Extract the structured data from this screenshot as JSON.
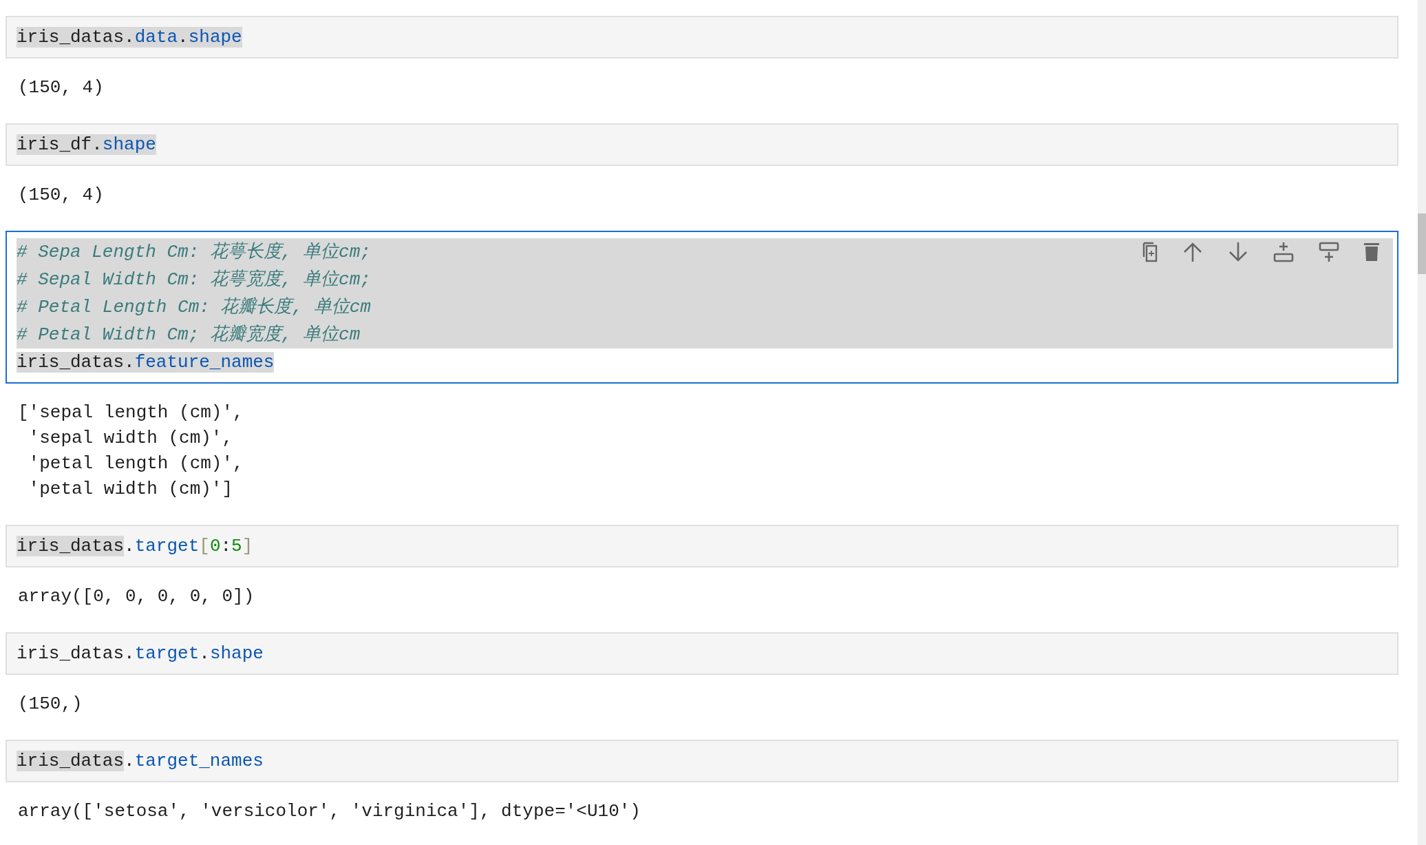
{
  "cells": [
    {
      "kind": "code",
      "selected": false,
      "lines": [
        {
          "selected": false,
          "tokens": [
            {
              "text": "iris_datas",
              "kind": "name",
              "highlighted": true
            },
            {
              "text": ".",
              "kind": "punct",
              "highlighted": true
            },
            {
              "text": "data",
              "kind": "attr",
              "highlighted": true
            },
            {
              "text": ".",
              "kind": "punct",
              "highlighted": true
            },
            {
              "text": "shape",
              "kind": "attr",
              "highlighted": true
            }
          ]
        }
      ],
      "output": [
        "(150, 4)"
      ]
    },
    {
      "kind": "code",
      "selected": false,
      "lines": [
        {
          "selected": false,
          "tokens": [
            {
              "text": "iris_df",
              "kind": "name",
              "highlighted": true
            },
            {
              "text": ".",
              "kind": "punct",
              "highlighted": true
            },
            {
              "text": "shape",
              "kind": "attr",
              "highlighted": true
            }
          ]
        }
      ],
      "output": [
        "(150, 4)"
      ]
    },
    {
      "kind": "code",
      "selected": true,
      "lines": [
        {
          "selected": true,
          "tokens": [
            {
              "text": "# Sepa Length Cm: 花萼长度, 单位cm;",
              "kind": "comment"
            }
          ]
        },
        {
          "selected": true,
          "tokens": [
            {
              "text": "# Sepal Width Cm: 花萼宽度, 单位cm;",
              "kind": "comment"
            }
          ]
        },
        {
          "selected": true,
          "tokens": [
            {
              "text": "# Petal Length Cm: 花瓣长度, 单位cm",
              "kind": "comment"
            }
          ]
        },
        {
          "selected": true,
          "tokens": [
            {
              "text": "# Petal Width Cm; 花瓣宽度, 单位cm",
              "kind": "comment"
            }
          ]
        },
        {
          "selected": false,
          "tokens": [
            {
              "text": "iris_datas",
              "kind": "name",
              "highlighted": true
            },
            {
              "text": ".",
              "kind": "punct",
              "highlighted": true
            },
            {
              "text": "feature_names",
              "kind": "attr",
              "highlighted": true
            }
          ]
        }
      ],
      "output": [
        "['sepal length (cm)',",
        " 'sepal width (cm)',",
        " 'petal length (cm)',",
        " 'petal width (cm)']"
      ]
    },
    {
      "kind": "code",
      "selected": false,
      "lines": [
        {
          "selected": false,
          "tokens": [
            {
              "text": "iris_datas",
              "kind": "name",
              "highlighted": true
            },
            {
              "text": ".",
              "kind": "punct",
              "highlighted": false
            },
            {
              "text": "target",
              "kind": "attr",
              "highlighted": false
            },
            {
              "text": "[",
              "kind": "bracket",
              "highlighted": false
            },
            {
              "text": "0",
              "kind": "number",
              "highlighted": false
            },
            {
              "text": ":",
              "kind": "punct",
              "highlighted": false
            },
            {
              "text": "5",
              "kind": "number",
              "highlighted": false
            },
            {
              "text": "]",
              "kind": "bracket",
              "highlighted": false
            }
          ]
        }
      ],
      "output": [
        "array([0, 0, 0, 0, 0])"
      ]
    },
    {
      "kind": "code",
      "selected": false,
      "lines": [
        {
          "selected": false,
          "tokens": [
            {
              "text": "iris_datas",
              "kind": "name",
              "highlighted": false
            },
            {
              "text": ".",
              "kind": "punct",
              "highlighted": false
            },
            {
              "text": "target",
              "kind": "attr",
              "highlighted": false
            },
            {
              "text": ".",
              "kind": "punct",
              "highlighted": false
            },
            {
              "text": "shape",
              "kind": "attr",
              "highlighted": false
            }
          ]
        }
      ],
      "output": [
        "(150,)"
      ]
    },
    {
      "kind": "code",
      "selected": false,
      "lines": [
        {
          "selected": false,
          "tokens": [
            {
              "text": "iris_datas",
              "kind": "name",
              "highlighted": true
            },
            {
              "text": ".",
              "kind": "punct",
              "highlighted": false
            },
            {
              "text": "target_names",
              "kind": "attr",
              "highlighted": false
            }
          ]
        }
      ],
      "output": [
        "array(['setosa', 'versicolor', 'virginica'], dtype='<U10')"
      ]
    }
  ]
}
